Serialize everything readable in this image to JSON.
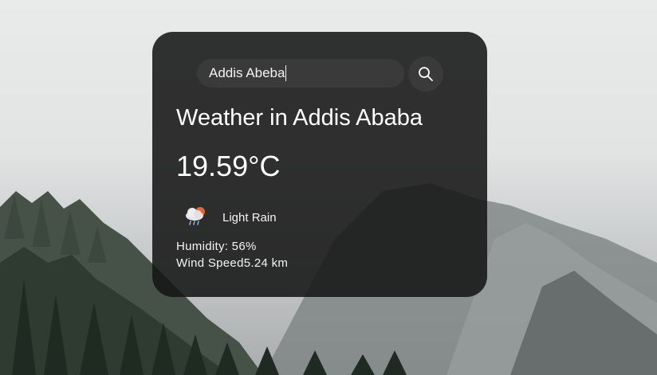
{
  "search": {
    "value": "Addis Abeba",
    "button_icon": "search-icon"
  },
  "weather": {
    "title": "Weather in Addis Ababa",
    "temperature": "19.59°C",
    "condition_icon": "cloud-sun-rain-icon",
    "condition": "Light Rain",
    "humidity": "Humidity: 56%",
    "wind": "Wind Speed5.24 km"
  },
  "colors": {
    "card_background": "#161616",
    "search_background": "#3a3a3a",
    "text": "#ffffff"
  }
}
